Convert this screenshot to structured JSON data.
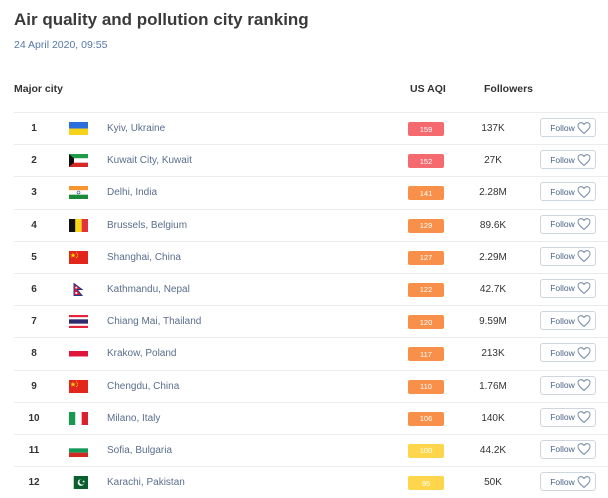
{
  "page": {
    "title": "Air quality and pollution city ranking",
    "date": "24 April 2020, 09:55"
  },
  "table": {
    "headers": {
      "city": "Major city",
      "aqi": "US AQI",
      "followers": "Followers"
    },
    "follow_label": "Follow",
    "rows": [
      {
        "rank": "1",
        "city": "Kyiv, Ukraine",
        "aqi": "159",
        "aqi_color": "#f46a6f",
        "followers": "137K",
        "flag": "ukraine-flag-icon"
      },
      {
        "rank": "2",
        "city": "Kuwait City, Kuwait",
        "aqi": "152",
        "aqi_color": "#f46a6f",
        "followers": "27K",
        "flag": "kuwait-flag-icon"
      },
      {
        "rank": "3",
        "city": "Delhi, India",
        "aqi": "141",
        "aqi_color": "#f99049",
        "followers": "2.28M",
        "flag": "india-flag-icon"
      },
      {
        "rank": "4",
        "city": "Brussels, Belgium",
        "aqi": "129",
        "aqi_color": "#f99049",
        "followers": "89.6K",
        "flag": "belgium-flag-icon"
      },
      {
        "rank": "5",
        "city": "Shanghai, China",
        "aqi": "127",
        "aqi_color": "#f99049",
        "followers": "2.29M",
        "flag": "china-flag-icon"
      },
      {
        "rank": "6",
        "city": "Kathmandu, Nepal",
        "aqi": "122",
        "aqi_color": "#f99049",
        "followers": "42.7K",
        "flag": "nepal-flag-icon"
      },
      {
        "rank": "7",
        "city": "Chiang Mai, Thailand",
        "aqi": "120",
        "aqi_color": "#f99049",
        "followers": "9.59M",
        "flag": "thailand-flag-icon"
      },
      {
        "rank": "8",
        "city": "Krakow, Poland",
        "aqi": "117",
        "aqi_color": "#f99049",
        "followers": "213K",
        "flag": "poland-flag-icon"
      },
      {
        "rank": "9",
        "city": "Chengdu, China",
        "aqi": "110",
        "aqi_color": "#f99049",
        "followers": "1.76M",
        "flag": "china-flag-icon"
      },
      {
        "rank": "10",
        "city": "Milano, Italy",
        "aqi": "106",
        "aqi_color": "#f99049",
        "followers": "140K",
        "flag": "italy-flag-icon"
      },
      {
        "rank": "11",
        "city": "Sofia, Bulgaria",
        "aqi": "100",
        "aqi_color": "#fdd64b",
        "followers": "44.2K",
        "flag": "bulgaria-flag-icon"
      },
      {
        "rank": "12",
        "city": "Karachi, Pakistan",
        "aqi": "95",
        "aqi_color": "#fdd64b",
        "followers": "50K",
        "flag": "pakistan-flag-icon"
      }
    ]
  }
}
